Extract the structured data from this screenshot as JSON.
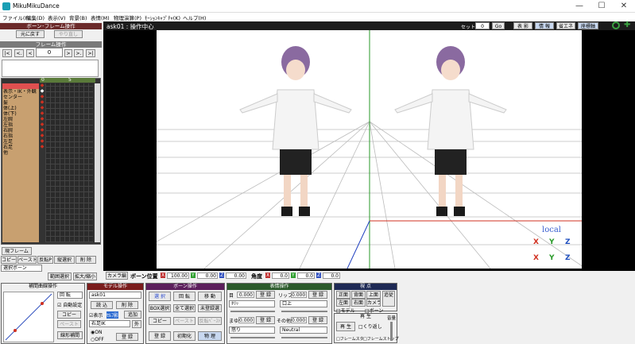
{
  "window": {
    "title": "MikuMikuDance",
    "min": "—",
    "max": "☐",
    "close": "✕"
  },
  "menu": [
    "ファイル(F)",
    "編集(D)",
    "表示(V)",
    "背景(B)",
    "表情(M)",
    "物理演算(P)",
    "ﾓｰｼｮﾝｷｬﾌﾟﾁｬ(K)",
    "ヘルプ(H)"
  ],
  "left": {
    "header": "ボーン･フレーム操作",
    "undo": "元に戻す",
    "redo": "やり直し",
    "frame_header": "フレーム操作",
    "frame_value": "0",
    "nav": [
      "|<",
      "<.",
      ">",
      ">.",
      ">|"
    ],
    "nav_left": "<",
    "tracks": [
      "0",
      "5"
    ],
    "bones": [
      "表示・IK・外観",
      "センター",
      "髪",
      "体(上)",
      "体(下)",
      "左腕",
      "左指",
      "右腕",
      "右指",
      "左足",
      "右足",
      "他"
    ],
    "bone_flags": [
      "◆",
      "◆",
      "◆",
      "◆",
      "◆",
      "◆",
      "◆",
      "◆",
      "◆",
      "◆",
      "◆",
      "◆"
    ],
    "current_frame_btn": "現フレーム",
    "row1": [
      "コピー",
      "ペースト",
      "反転P",
      "縦選択",
      "削 除"
    ],
    "select_bone": "選択ボーン",
    "range_select": "範囲選択",
    "expand": "拡大/縮小"
  },
  "viewport": {
    "title": "ask01 : 操作中心",
    "set_label": "セット",
    "set_value": "0",
    "go": "Go",
    "buttons": [
      "表 影",
      "情 報",
      "省エネ",
      "座標軸"
    ],
    "local": "local",
    "gizmo": [
      "X",
      "Y",
      "Z",
      "X",
      "Y",
      "Z"
    ]
  },
  "statusbar": {
    "camera": "カメラ編",
    "bone_pos": "ボーン位置",
    "x_lbl": "X",
    "x_val": "100.00",
    "y_lbl": "Y",
    "y_val": "0.00",
    "z_lbl": "Z",
    "z_val": "0.00",
    "angle": "角度",
    "ax_lbl": "X",
    "ax_val": "0.0",
    "ay_lbl": "Y",
    "ay_val": "0.0",
    "az_lbl": "Z",
    "az_val": "0.0"
  },
  "interp": {
    "header": "補間曲線操作",
    "rotate": "回 転",
    "auto": "自動設定",
    "copy": "コピー",
    "paste": "ペースト",
    "linear": "線形補間"
  },
  "model": {
    "header": "モデル操作",
    "name": "ask01",
    "load": "読 込",
    "delete": "削 除",
    "display": "表示",
    "selfshadow": "ｾﾙﾌ影",
    "add": "追加",
    "bone": "右足IK",
    "outside": "外",
    "on": "ON",
    "off": "OFF",
    "register": "登 録"
  },
  "bone": {
    "header": "ボーン操作",
    "select": "選 択",
    "rotate": "回 転",
    "move": "移 動",
    "box": "BOX選択",
    "all": "全て選択",
    "unreg": "未登録選",
    "copy": "コピー",
    "paste": "ペースト",
    "revpaste": "反転ﾍﾟｰｽﾄ",
    "register": "登 録",
    "init": "初期化",
    "physics": "物 理"
  },
  "facial": {
    "header": "表情操作",
    "eye": "目",
    "lip": "リップ",
    "brow": "まゆ",
    "other": "その他",
    "val1": "0.000",
    "val2": "0.000",
    "val3": "0.000",
    "val4": "0.000",
    "reg": "登 録",
    "m1": "ｷﾘｯ",
    "m2": "口上",
    "m3": "怒り",
    "m4": "Neutral"
  },
  "view": {
    "header": "視 点",
    "front": "正面",
    "back": "背面",
    "top": "上面",
    "left": "左面",
    "right": "右面",
    "camera": "カメラ",
    "track": "追従",
    "model": "モデル",
    "bone": "ボーン"
  },
  "play": {
    "header": "再 生",
    "play": "再 生",
    "repeat": "くり返し",
    "frame_start": "フレームスタ",
    "frame_stop": "フレームストップ",
    "volume": "音量"
  },
  "colors": {
    "header_dark": "#6b2a2a",
    "model_header": "#7a1c1c",
    "bone_header": "#5c1f5c",
    "facial_header": "#2b5a2b",
    "view_header": "#1e2a55",
    "accent_red": "#d03020"
  }
}
